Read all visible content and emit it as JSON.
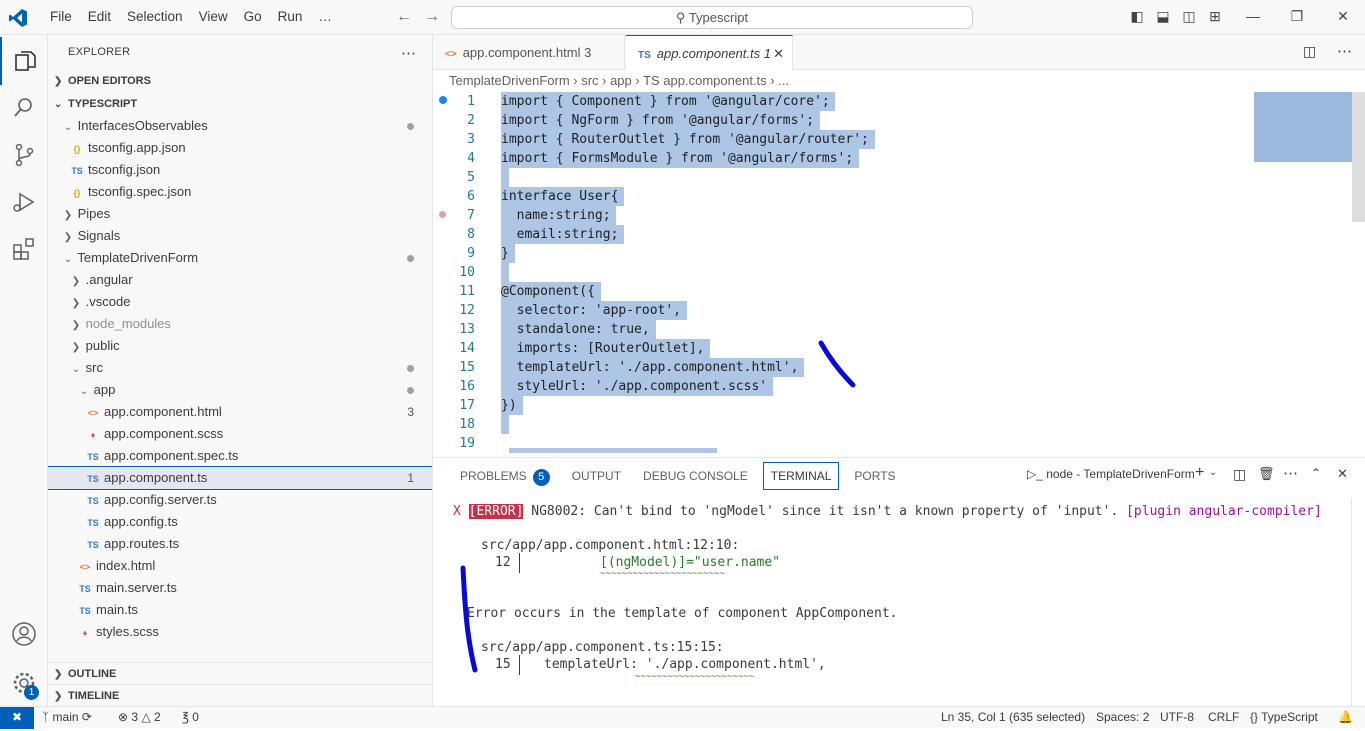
{
  "menu": [
    "File",
    "Edit",
    "Selection",
    "View",
    "Go",
    "Run",
    "…"
  ],
  "command_center": "Typescript",
  "sidebar": {
    "title": "EXPLORER",
    "open_editors": "OPEN EDITORS",
    "project": "TYPESCRIPT",
    "tree": [
      {
        "label": "InterfacesObservables",
        "type": "folder",
        "open": true,
        "depth": 1,
        "dot": true
      },
      {
        "label": "tsconfig.app.json",
        "type": "json",
        "depth": 2
      },
      {
        "label": "tsconfig.json",
        "type": "ts",
        "depth": 2
      },
      {
        "label": "tsconfig.spec.json",
        "type": "json",
        "depth": 2
      },
      {
        "label": "Pipes",
        "type": "folder",
        "open": false,
        "depth": 1
      },
      {
        "label": "Signals",
        "type": "folder",
        "open": false,
        "depth": 1
      },
      {
        "label": "TemplateDrivenForm",
        "type": "folder",
        "open": true,
        "depth": 1,
        "dot": true
      },
      {
        "label": ".angular",
        "type": "folder",
        "open": false,
        "depth": 2
      },
      {
        "label": ".vscode",
        "type": "folder",
        "open": false,
        "depth": 2
      },
      {
        "label": "node_modules",
        "type": "folder",
        "open": false,
        "depth": 2,
        "muted": true
      },
      {
        "label": "public",
        "type": "folder",
        "open": false,
        "depth": 2
      },
      {
        "label": "src",
        "type": "folder",
        "open": true,
        "depth": 2,
        "dot": true
      },
      {
        "label": "app",
        "type": "folder",
        "open": true,
        "depth": 3,
        "dot": true
      },
      {
        "label": "app.component.html",
        "type": "html",
        "depth": 4,
        "count": "3"
      },
      {
        "label": "app.component.scss",
        "type": "scss",
        "depth": 4
      },
      {
        "label": "app.component.spec.ts",
        "type": "ts",
        "depth": 4
      },
      {
        "label": "app.component.ts",
        "type": "ts",
        "depth": 4,
        "count": "1",
        "selected": true
      },
      {
        "label": "app.config.server.ts",
        "type": "ts",
        "depth": 4
      },
      {
        "label": "app.config.ts",
        "type": "ts",
        "depth": 4
      },
      {
        "label": "app.routes.ts",
        "type": "ts",
        "depth": 4
      },
      {
        "label": "index.html",
        "type": "html",
        "depth": 3
      },
      {
        "label": "main.server.ts",
        "type": "ts",
        "depth": 3
      },
      {
        "label": "main.ts",
        "type": "ts",
        "depth": 3
      },
      {
        "label": "styles.scss",
        "type": "scss",
        "depth": 3
      }
    ],
    "outline": "OUTLINE",
    "timeline": "TIMELINE"
  },
  "tabs": [
    {
      "label": "app.component.html",
      "badge": "3",
      "icon": "<>"
    },
    {
      "label": "app.component.ts",
      "badge": "1",
      "icon": "TS",
      "active": true
    }
  ],
  "breadcrumb": "TemplateDrivenForm  ›  src  ›  app  ›  TS  app.component.ts  ›  ...",
  "code_lines": [
    "import { Component } from '@angular/core';",
    "import { NgForm } from '@angular/forms';",
    "import { RouterOutlet } from '@angular/router';",
    "import { FormsModule } from '@angular/forms';",
    "",
    "interface User{",
    "  name:string;",
    "  email:string;",
    "}",
    "",
    "@Component({",
    "  selector: 'app-root',",
    "  standalone: true,",
    "  imports: [RouterOutlet],",
    "  templateUrl: './app.component.html',",
    "  styleUrl: './app.component.scss'",
    "})",
    "",
    ""
  ],
  "panel": {
    "tabs": [
      "PROBLEMS",
      "OUTPUT",
      "DEBUG CONSOLE",
      "TERMINAL",
      "PORTS"
    ],
    "problems_count": "5",
    "terminal_name": "node - TemplateDrivenForm",
    "error_x": "X",
    "error_tag": "[ERROR]",
    "error_msg": " NG8002: Can't bind to 'ngModel' since it isn't a known property of 'input'. ",
    "error_plugin": "[plugin angular-compiler]",
    "loc1": "src/app/app.component.html:12:10:",
    "loc1_num": "12",
    "loc1_code": "[(ngModel)]=\"user.name\"",
    "squiggle1": "~~~~~~~~~~~~~~~~~~~~~~~",
    "note": "Error occurs in the template of component AppComponent.",
    "loc2": "src/app/app.component.ts:15:15:",
    "loc2_num": "15",
    "loc2_code": "templateUrl: './app.component.html',",
    "squiggle2": "~~~~~~~~~~~~~~~~~~~~~~"
  },
  "status": {
    "branch": "main",
    "errors": "3",
    "warnings": "2",
    "ports": "0",
    "position": "Ln 35, Col 1 (635 selected)",
    "spaces": "Spaces: 2",
    "encoding": "UTF-8",
    "eol": "CRLF",
    "language": "TypeScript"
  },
  "accounts_badge": "1",
  "colors": {
    "accent": "#005fb8",
    "selection": "#adc6e5",
    "error": "#c4314b",
    "annotation": "#0a0ad8"
  }
}
